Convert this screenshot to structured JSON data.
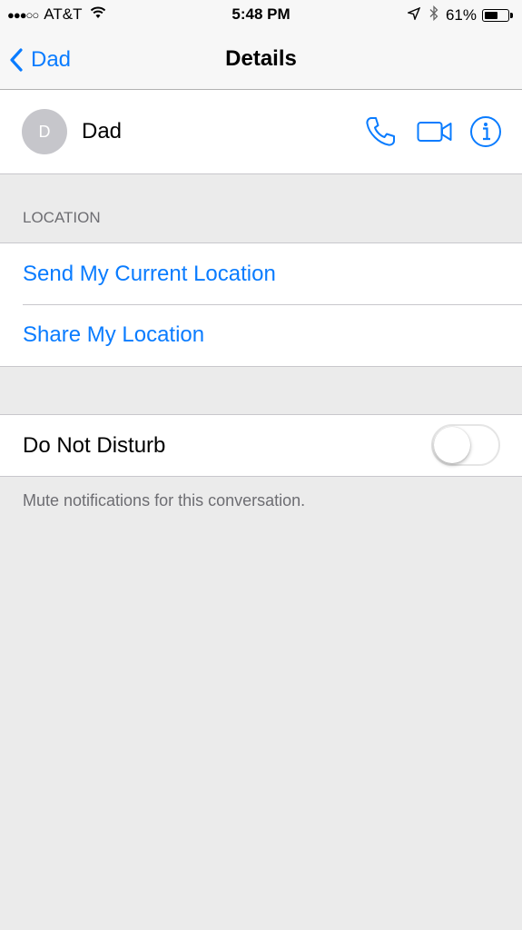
{
  "status_bar": {
    "signal": "●●●○○",
    "carrier": "AT&T",
    "wifi_icon": "wifi-icon",
    "time": "5:48 PM",
    "location_icon": "location-arrow-icon",
    "bluetooth_icon": "bluetooth-icon",
    "battery_percent": "61%",
    "battery_level": 0.61
  },
  "nav": {
    "back_label": "Dad",
    "title": "Details"
  },
  "contact": {
    "initial": "D",
    "name": "Dad",
    "actions": [
      "phone-icon",
      "video-camera-icon",
      "info-icon"
    ]
  },
  "location_section": {
    "header": "LOCATION",
    "items": [
      "Send My Current Location",
      "Share My Location"
    ]
  },
  "dnd": {
    "label": "Do Not Disturb",
    "enabled": false,
    "footnote": "Mute notifications for this conversation."
  },
  "colors": {
    "accent": "#0a7cff",
    "background": "#ebebeb",
    "secondary_text": "#6d6d72"
  }
}
